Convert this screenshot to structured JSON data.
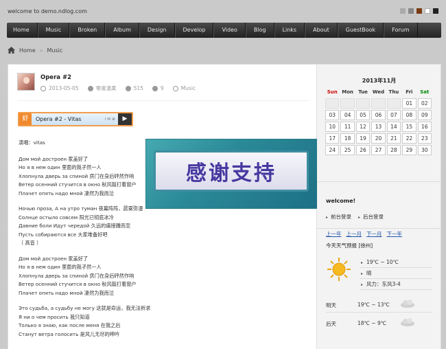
{
  "header": {
    "welcome": "welcome to demo.ndlog.com",
    "swatch_colors": [
      "#aaaaaa",
      "#888888",
      "#7a3c12",
      "#ffffff",
      "#222222"
    ]
  },
  "nav": {
    "items": [
      "Home",
      "Music",
      "Broken",
      "Album",
      "Design",
      "Develop",
      "Video",
      "Blog",
      "Links",
      "About",
      "GuestBook",
      "Forum"
    ]
  },
  "breadcrumb": {
    "home": "Home",
    "sep": "»",
    "current": "Music"
  },
  "post": {
    "title": "Opera #2",
    "date": "2013-05-05",
    "author": "零度温柔",
    "views": "515",
    "comments": "9",
    "category": "Music",
    "player_logo": "虾",
    "player_title": "Opera #2 - Vitas",
    "player_ctrls": "i ✉ ⊕",
    "player_play": "▶",
    "singer": "演唱：vitas",
    "stanzas": [
      [
        "Дом мой достроен 家盖好了",
        "Но я в нем один 里面的我孑然一人",
        "Хлопнула дверь за спиной 房门在身后砰然作响",
        "Ветер осенний стучится в окно 秋风敲打着窗户",
        "Плачет опять надо мной 凄然为我而泣"
      ],
      [
        "Ночью проза, А на утро туман 夜幕阵阵，晨雾弥漫",
        "Солнце остыло совсем 阳光已彻底冰冷",
        "Давние боли Идут чередой 久远的痛接踵而至",
        "Пусть собираются все 大家堆备好吧",
        "（ 高音 ）"
      ],
      [
        "Дом мой достроен 家盖好了",
        "Но я в нем один 里面的我孑然一人",
        "Хлопнула дверь за спиной 房门在身后砰然作响",
        "Ветер осенний стучится в окно 秋风敲打着窗户",
        "Плачет опять надо мной 凄然为我而泣"
      ],
      [
        "Это судьба, а судьбу не могу 这就是命运，我无法祈求",
        "Я ни о чем просить 我只知道",
        "Только я знаю, как после меня 在我之后",
        "Станут ветра голосить 是风儿无尽的呻吟"
      ]
    ],
    "banner_text": "感谢支持"
  },
  "calendar": {
    "title": "2013年11月",
    "weekdays": [
      "Sun",
      "Mon",
      "Tue",
      "Wed",
      "Thu",
      "Fri",
      "Sat"
    ],
    "cells": [
      "",
      "",
      "",
      "",
      "",
      "01",
      "02",
      "03",
      "04",
      "05",
      "06",
      "07",
      "08",
      "09",
      "10",
      "11",
      "12",
      "13",
      "14",
      "15",
      "16",
      "17",
      "18",
      "19",
      "20",
      "21",
      "22",
      "23",
      "24",
      "25",
      "26",
      "27",
      "28",
      "29",
      "30"
    ],
    "nav": [
      "上一年",
      "上一月",
      "下一月",
      "下一年"
    ]
  },
  "welcome_widget": {
    "title": "welcome!",
    "links": [
      "前台登录",
      "后台登录"
    ]
  },
  "weather": {
    "title": "今天天气预报 [徐州]",
    "today": [
      "19℃ ~ 10℃",
      "晴",
      "风力：东风3-4"
    ],
    "forecast": [
      {
        "day": "明天",
        "temp": "19℃ ~ 13℃"
      },
      {
        "day": "后天",
        "temp": "18℃ ~ 9℃"
      }
    ]
  }
}
